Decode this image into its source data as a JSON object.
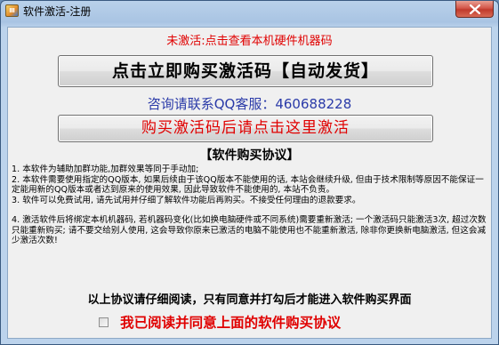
{
  "window": {
    "title": "软件激活-注册",
    "icon": "app-icon"
  },
  "status": {
    "text": "未激活:点击查看本机硬件机器码"
  },
  "buy_button": {
    "label": "点击立即购买激活码【自动发货】"
  },
  "contact": {
    "text": "咨询请联系QQ客服：460688228"
  },
  "activate_button": {
    "label": "购买激活码后请点击这里激活"
  },
  "agreement": {
    "heading": "【软件购买协议】",
    "paragraphs": [
      "1. 本软件为辅助加群功能,加群效果等同于手动加;",
      "2. 本软件需要使用指定的QQ版本, 如果后续由于该QQ版本不能使用的话, 本站会继续升级, 但由于技术限制等原因不能保证一定能用新的QQ版本或者达到原来的使用效果, 因此导致软件不能使用的, 本站不负责。",
      "3. 软件可以免费试用, 请先试用并仔细了解软件功能后再购买。不接受任何理由的退款要求。",
      "4. 激活软件后将绑定本机机器码, 若机器码变化(比如换电脑硬件或不同系统)需要重新激活; 一个激活码只能激活3次, 超过次数只能重新购买; 请不要交给别人使用, 这会导致你原来已激活的电脑不能使用也不能重新激活, 除非你更换新电脑激活, 但这会减少激活次数!"
    ]
  },
  "notice": {
    "text": "以上协议请仔细阅读，只有同意并打勾后才能进入软件购买界面"
  },
  "agree_checkbox": {
    "label": "我已阅读并同意上面的软件购买协议",
    "checked": false
  },
  "colors": {
    "accent_red": "#e00000",
    "contact_blue": "#2a3aa8"
  }
}
